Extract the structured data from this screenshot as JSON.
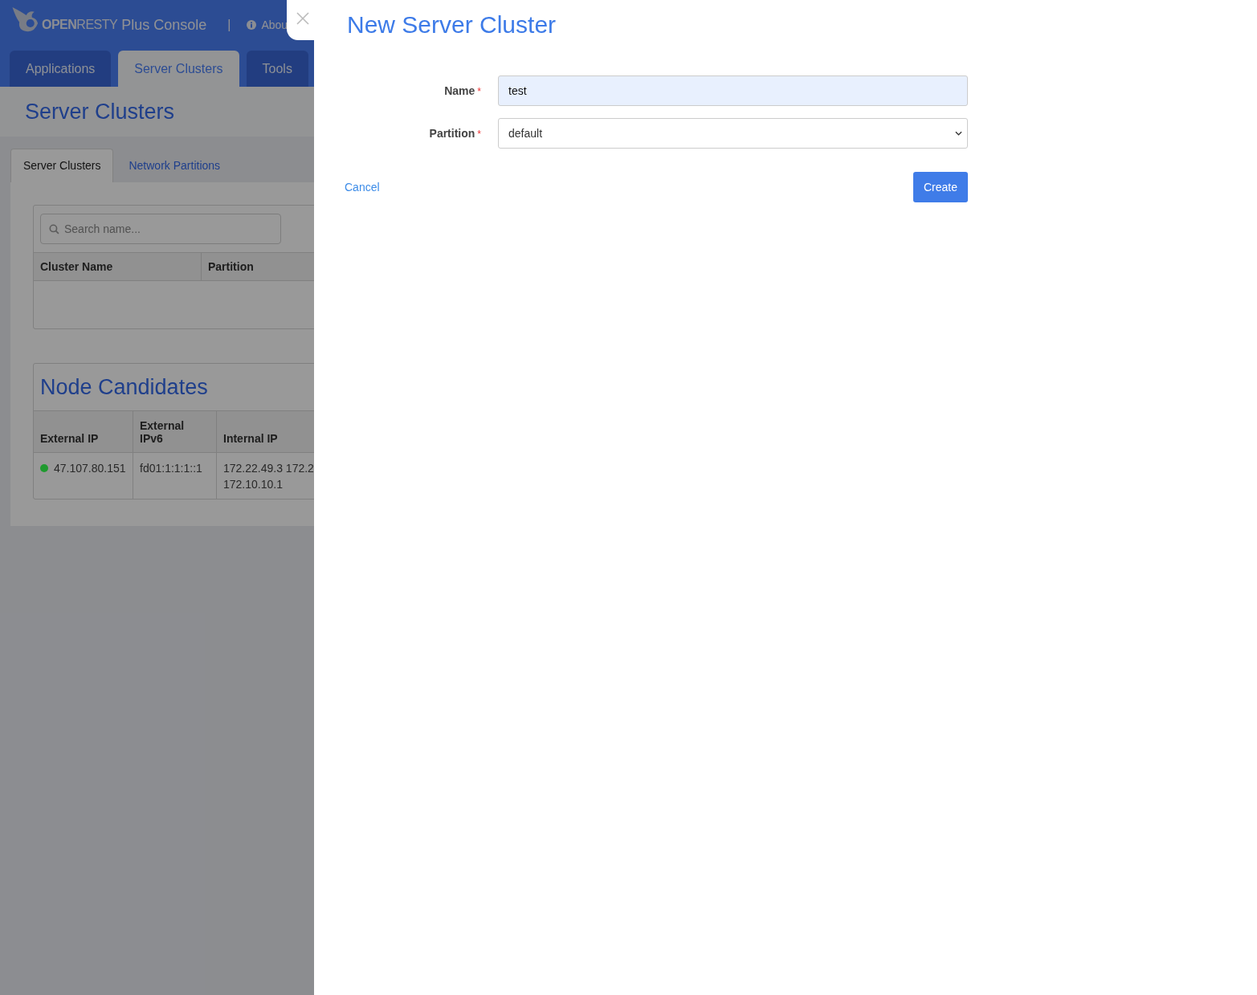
{
  "background_page": {
    "header": {
      "logo": "**OPEN**RESTY",
      "product": "Plus Console",
      "separator": "|",
      "about_link": "Abou"
    },
    "tabs": [
      {
        "label": "Applications",
        "selected": false
      },
      {
        "label": "Server Clusters",
        "selected": true
      },
      {
        "label": "Tools",
        "selected": false
      }
    ],
    "page_title": "Server Clusters",
    "sub_tabs": [
      {
        "label": "Server Clusters",
        "selected": true
      },
      {
        "label": "Network Partitions",
        "selected": false
      }
    ],
    "search": {
      "placeholder": "Search name..."
    },
    "clusters_table": {
      "columns": [
        "Cluster Name",
        "Partition"
      ]
    },
    "node_candidates": {
      "title": "Node Candidates",
      "columns": [
        "External IP",
        "External IPv6",
        "Internal IP"
      ],
      "rows": [
        {
          "color": "#1f9a2f",
          "external_ip": "47.107.80.151",
          "external_ipv6": "fd01:1:1:1::1",
          "internal_ip": "172.22.49.3 172.2\n172.10.10.1"
        }
      ]
    }
  },
  "drawer": {
    "title": "New Server Cluster",
    "fields": [
      {
        "kind": "text",
        "label": "Name",
        "required_mark": "*",
        "value": "test"
      },
      {
        "kind": "select",
        "label": "Partition",
        "required_mark": "*",
        "value": "default"
      }
    ],
    "cancel": "Cancel",
    "submit": "Create"
  }
}
